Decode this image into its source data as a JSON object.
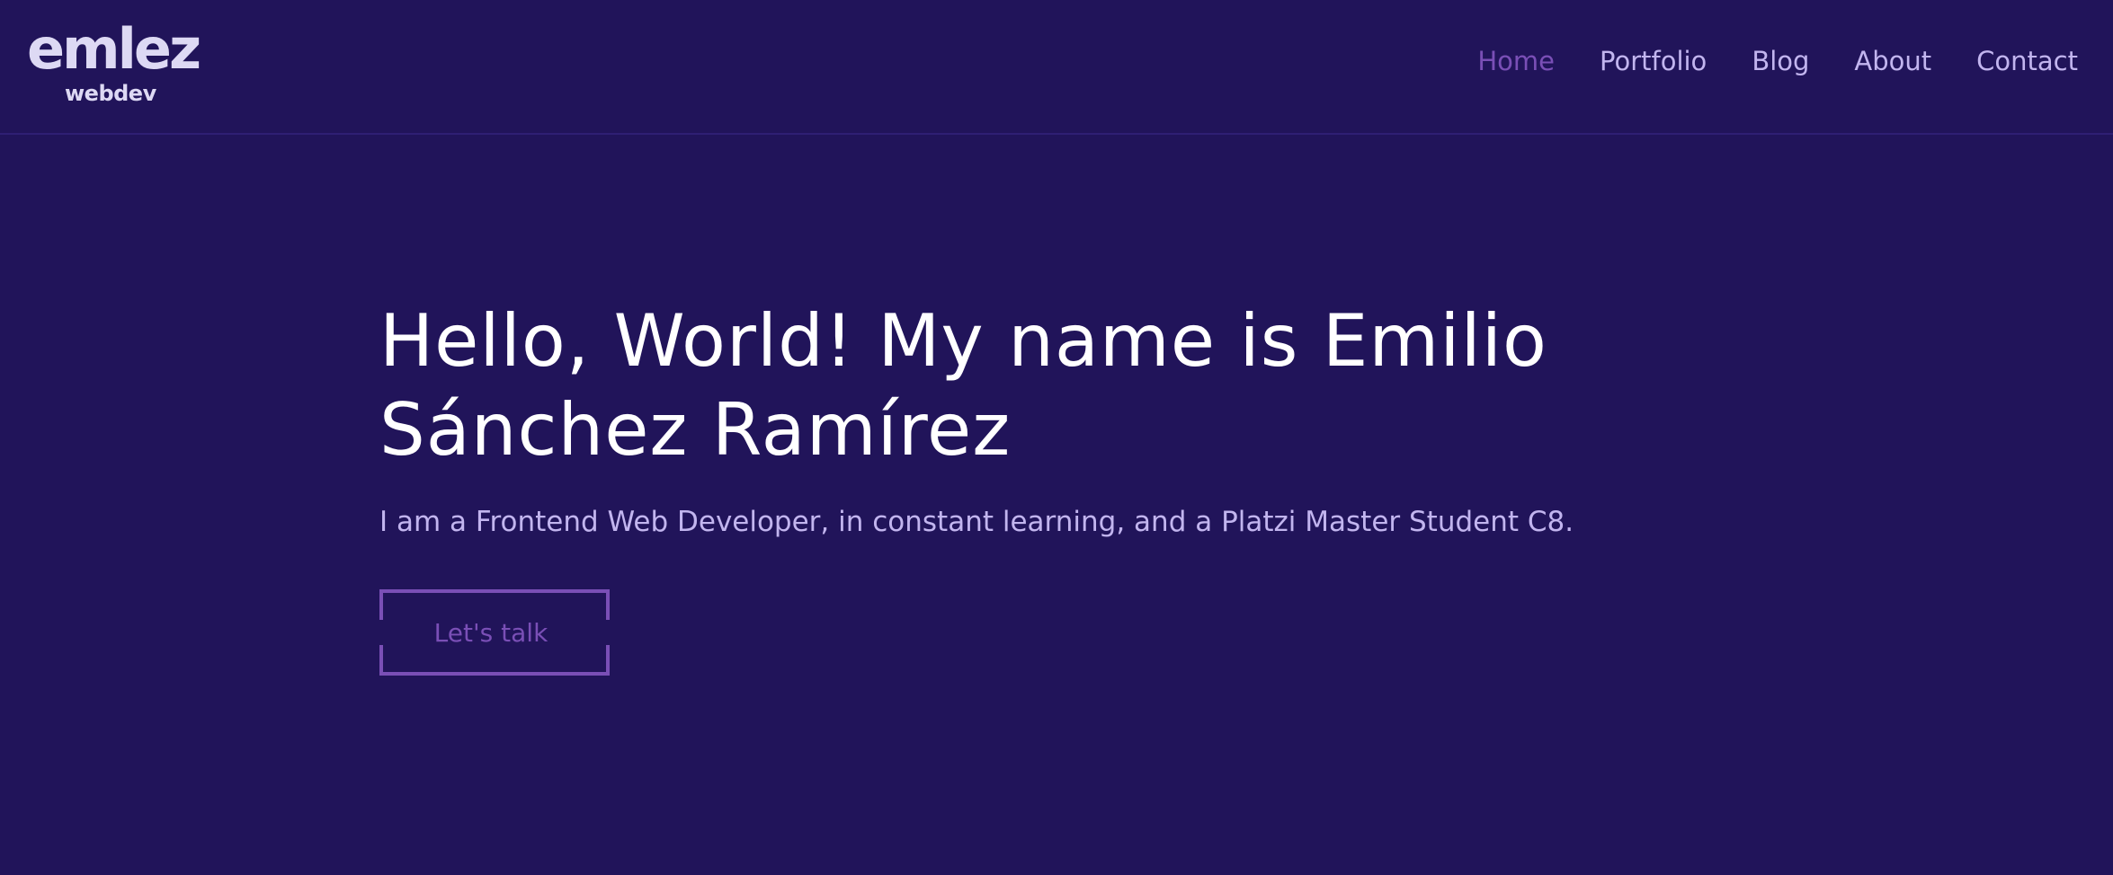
{
  "header": {
    "logo": {
      "wordmark": "emlez",
      "subtitle": "webdev"
    },
    "nav": {
      "items": [
        {
          "label": "Home",
          "active": true
        },
        {
          "label": "Portfolio",
          "active": false
        },
        {
          "label": "Blog",
          "active": false
        },
        {
          "label": "About",
          "active": false
        },
        {
          "label": "Contact",
          "active": false
        }
      ]
    }
  },
  "hero": {
    "title": "Hello, World! My name is Emilio Sánchez Ramírez",
    "subtitle": "I am a Frontend Web Developer, in constant learning, and a Platzi Master Student C8.",
    "cta_label": "Let's talk"
  },
  "colors": {
    "background": "#21145a",
    "accent": "#7a4fb6",
    "nav_text": "#c2b5ef",
    "title_text": "#ffffff"
  }
}
